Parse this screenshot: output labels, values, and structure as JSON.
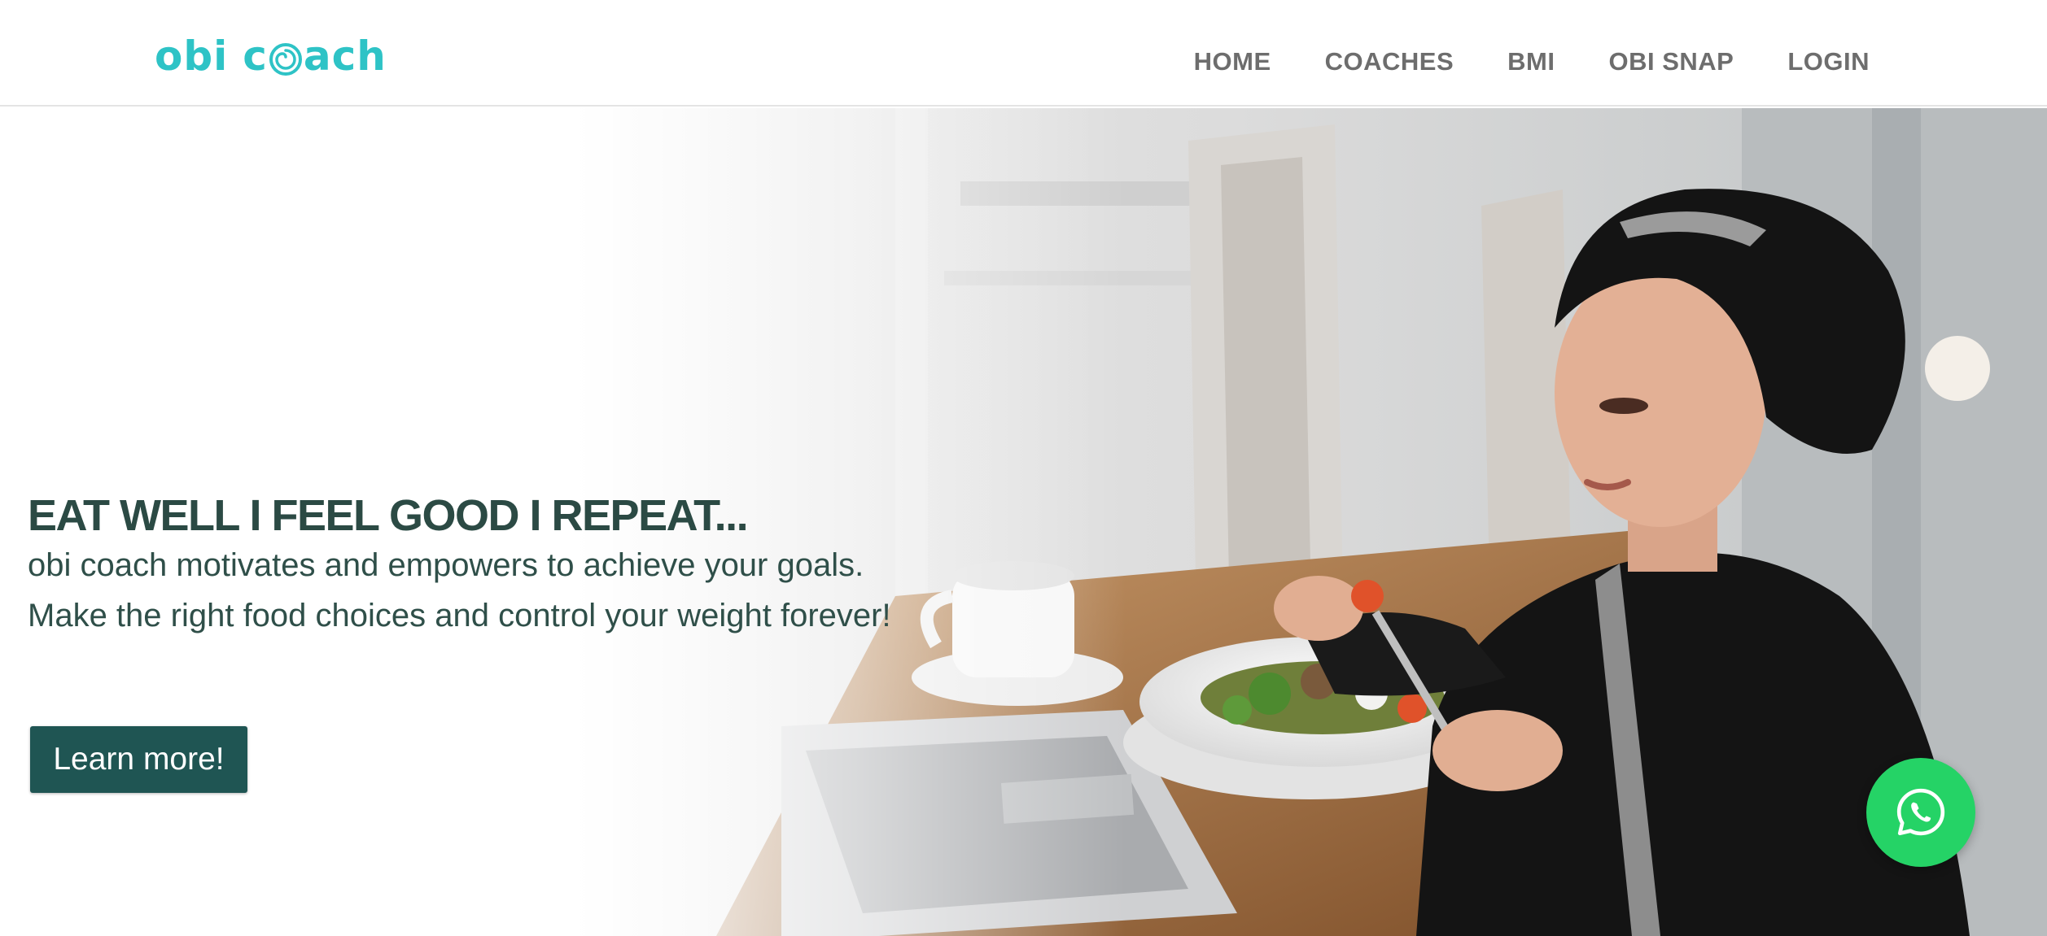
{
  "brand": {
    "logo_part1": "obi",
    "logo_part2": "c",
    "logo_part3": "ach",
    "color": "#2ec3c6"
  },
  "nav": {
    "items": [
      {
        "label": "HOME"
      },
      {
        "label": "COACHES"
      },
      {
        "label": "BMI"
      },
      {
        "label": "OBI SNAP"
      },
      {
        "label": "LOGIN"
      }
    ]
  },
  "hero": {
    "headline": "EAT WELL I FEEL GOOD I REPEAT...",
    "line1": "obi coach motivates and empowers to achieve your goals.",
    "line2": "Make the right food choices and control your weight forever!",
    "cta_label": "Learn more!",
    "cta_color": "#1f5553",
    "text_color": "#2b4a44"
  },
  "whatsapp": {
    "icon": "whatsapp-icon",
    "color": "#25d366"
  }
}
